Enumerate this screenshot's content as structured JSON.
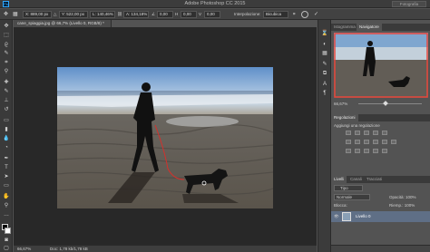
{
  "app": {
    "title": "Adobe Photoshop CC 2015",
    "workspace": "Fotografia"
  },
  "options": {
    "x": "X: 889,00 px",
    "y": "Y: 522,00 px",
    "w": "L: 140,46%",
    "h": "A: 134,18%",
    "angle": "0,00",
    "h_skew": "0,00",
    "v_skew": "0,00",
    "interp_label": "Interpolazione:",
    "interp_value": "Bicubica"
  },
  "document": {
    "tab": "cane_spiaggia.jpg @ 66,7% (Livello 0, RGB/8) *",
    "zoom": "66,67%",
    "doc_info": "Doc: 1,78 kb/1,78 kB"
  },
  "navigator": {
    "tabs": [
      "Istogramma",
      "Navigatore"
    ],
    "zoom": "66,67%"
  },
  "adjustments": {
    "title": "Regolazioni",
    "subtitle": "Aggiungi una regolazione"
  },
  "layers": {
    "tabs": [
      "Livelli",
      "Canali",
      "Tracciati"
    ],
    "kind_filter": "Tipo",
    "blend_mode": "Normale",
    "opacity_label": "Opacità: 100%",
    "lock_label": "Blocca:",
    "fill_label": "Riemp.: 100%",
    "layer_name": "Livello 0"
  },
  "colors": {
    "accent": "#e8463b",
    "bar": "#3c3c3c",
    "panel": "#535353"
  }
}
